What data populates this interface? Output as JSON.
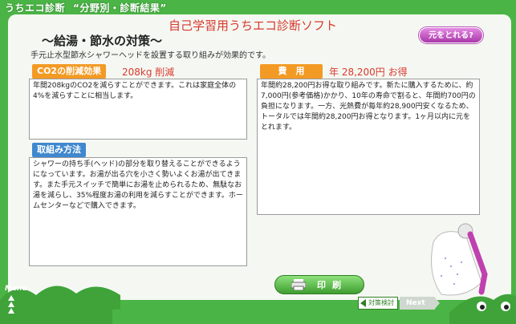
{
  "app": {
    "title": "うちエコ診断",
    "subtitle": "“分野別・診断結果”"
  },
  "software_title": "自己学習用うちエコ診断ソフト",
  "generation_button": "元をとれる?",
  "measure": {
    "title": "〜給湯・節水の対策〜",
    "description": "手元止水型節水シャワーヘッドを設置する取り組みが効果的です。"
  },
  "co2": {
    "label": "CO2の削減効果",
    "value": "208kg 削減",
    "text": "年間208kgのCO2を減らすことができます。これは家庭全体の4%を減らすことに相当します。"
  },
  "method": {
    "label": "取組み方法",
    "text": "シャワーの持ち手(ヘッド)の部分を取り替えることができるようになっています。お湯が出る穴を小さく勢いよくお湯が出てきます。また手元スイッチで簡単にお湯を止められるため、無駄なお湯を減らし、35%程度お湯の利用を減らすことができます。ホームセンターなどで購入できます。"
  },
  "cost": {
    "label": "費　用",
    "value": "年 28,200円 お得",
    "text": "年間約28,200円お得な取り組みです。新たに購入するために、約7,000円(参考価格)かかり、10年の寿命で割ると、年間約700円の負担になります。一方、光熱費が毎年約28,900円安くなるため、トータルでは年間約28,200円お得となります。1ヶ月以内に元をとれます。"
  },
  "print_button": "印刷",
  "menu_label": "Menu",
  "nav": {
    "prev": "対策検討",
    "next": "Next"
  },
  "colors": {
    "background": "#4bb446",
    "accent_orange": "#f39a24",
    "accent_blue": "#3f88cf",
    "highlight_red": "#d8382e",
    "button_purple": "#b04fb0"
  }
}
